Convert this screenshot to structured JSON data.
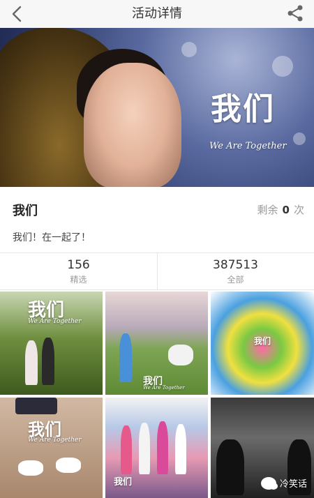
{
  "nav": {
    "title": "活动详情",
    "back_icon": "chevron-left-icon",
    "share_icon": "share-icon"
  },
  "hero": {
    "title": "我们",
    "subtitle": "We Are Together"
  },
  "activity": {
    "name": "我们",
    "remaining_label": "剩余",
    "remaining_count": "0",
    "remaining_unit": "次",
    "description": "我们！在一起了！"
  },
  "stats": [
    {
      "value": "156",
      "label": "精选"
    },
    {
      "value": "387513",
      "label": "全部"
    }
  ],
  "grid": {
    "tiles": [
      {
        "caption": "我们",
        "caption_sub": "We Are Together"
      },
      {
        "caption": "我们",
        "caption_sub": "We Are Together"
      },
      {
        "caption": "我们",
        "caption_sub": ""
      },
      {
        "caption": "我们",
        "caption_sub": "We Are Together"
      },
      {
        "caption": "我们",
        "caption_sub": ""
      },
      {
        "caption": "",
        "caption_sub": ""
      }
    ]
  },
  "watermark": {
    "text": "冷笑话"
  },
  "colors": {
    "header_bg": "#f7f7f7",
    "text_primary": "#333333",
    "text_secondary": "#999999"
  }
}
